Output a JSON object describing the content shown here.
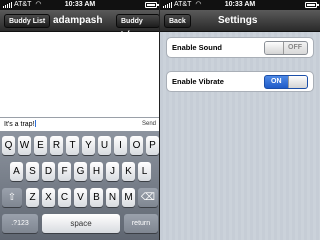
{
  "left": {
    "status": {
      "carrier": "AT&T",
      "time": "10:33 AM"
    },
    "nav": {
      "left_button": "Buddy List",
      "title": "adampash",
      "right_button": "Buddy Info"
    },
    "chat": {
      "message_text": "It's a trap!",
      "send_label": "Send"
    },
    "keyboard": {
      "row1": [
        "Q",
        "W",
        "E",
        "R",
        "T",
        "Y",
        "U",
        "I",
        "O",
        "P"
      ],
      "row2": [
        "A",
        "S",
        "D",
        "F",
        "G",
        "H",
        "J",
        "K",
        "L"
      ],
      "row3": [
        "Z",
        "X",
        "C",
        "V",
        "B",
        "N",
        "M"
      ],
      "numbers_key": ".?123",
      "space_key": "space",
      "return_key": "return",
      "shift_icon": "shift-arrow-icon",
      "backspace_icon": "backspace-icon"
    }
  },
  "right": {
    "status": {
      "carrier": "AT&T",
      "time": "10:33 AM"
    },
    "nav": {
      "back_button": "Back",
      "title": "Settings"
    },
    "settings": [
      {
        "label": "Enable Sound",
        "state": "OFF"
      },
      {
        "label": "Enable Vibrate",
        "state": "ON"
      }
    ]
  },
  "colors": {
    "nav_bar": "#3a3a3a",
    "switch_on": "#2f6fd8",
    "settings_bg": "#c5ccd4"
  }
}
